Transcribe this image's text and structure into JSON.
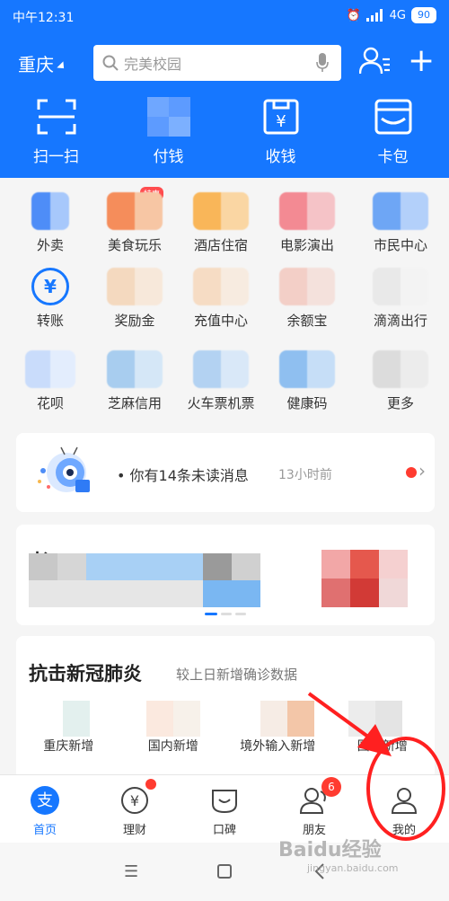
{
  "status_bar": {
    "time": "中午12:31",
    "network": "4G",
    "battery": "90"
  },
  "header": {
    "city": "重庆",
    "search_placeholder": "完美校园"
  },
  "main_actions": [
    {
      "label": "扫一扫",
      "icon": "scan-icon"
    },
    {
      "label": "付钱",
      "icon": "pay-icon"
    },
    {
      "label": "收钱",
      "icon": "receive-money-icon"
    },
    {
      "label": "卡包",
      "icon": "card-wallet-icon"
    }
  ],
  "grid": {
    "row1": [
      "外卖",
      "美食玩乐",
      "酒店住宿",
      "电影演出",
      "市民中心"
    ],
    "row2": [
      "转账",
      "奖励金",
      "充值中心",
      "余额宝",
      "滴滴出行"
    ],
    "row3": [
      "花呗",
      "芝麻信用",
      "火车票机票",
      "健康码",
      "更多"
    ],
    "hot_badge": "特惠"
  },
  "message": {
    "text": "你有14条未读消息",
    "time": "13小时前"
  },
  "promo": {
    "title": "老"
  },
  "covid": {
    "title": "抗击新冠肺炎",
    "subtitle": "较上日新增确诊数据",
    "stats": [
      "重庆新增",
      "国内新增",
      "境外输入新增",
      "国外新增"
    ]
  },
  "tabbar": {
    "tabs": [
      "首页",
      "理财",
      "口碑",
      "朋友",
      "我的"
    ],
    "friends_count": "6"
  },
  "watermark": {
    "main": "Baidu经验",
    "sub": "jingyan.baidu.com"
  },
  "colors": {
    "brand_blue": "#1677ff",
    "badge_red": "#ff3b30",
    "annotation_red": "#ff2020"
  }
}
